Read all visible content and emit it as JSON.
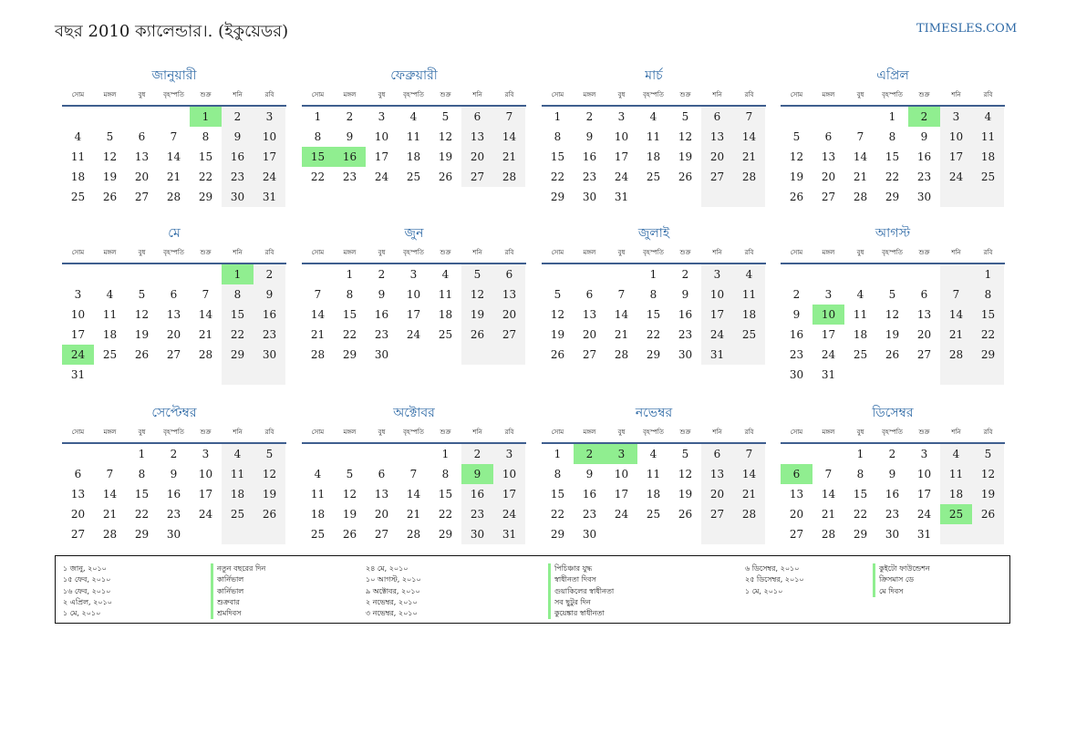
{
  "header": {
    "title": "বছর 2010 ক্যালেন্ডার।. (ইকুয়েডর)",
    "site": "TIMESLES.COM"
  },
  "weekdays": [
    "সোম",
    "মঙ্গল",
    "বুধ",
    "বৃহস্পতি",
    "শুক্র",
    "শনি",
    "রবি"
  ],
  "colors": {
    "holiday": "#90ee90",
    "weekend": "#f2f2f2",
    "accent": "#2f6aa6"
  },
  "months": [
    {
      "name": "জানুয়ারী",
      "offset": 4,
      "days": 31,
      "holidays": [
        1
      ]
    },
    {
      "name": "ফেব্রুয়ারী",
      "offset": 0,
      "days": 28,
      "holidays": [
        15,
        16
      ]
    },
    {
      "name": "মার্চ",
      "offset": 0,
      "days": 31,
      "holidays": []
    },
    {
      "name": "এপ্রিল",
      "offset": 3,
      "days": 30,
      "holidays": [
        2
      ]
    },
    {
      "name": "মে",
      "offset": 5,
      "days": 31,
      "holidays": [
        1,
        24
      ]
    },
    {
      "name": "জুন",
      "offset": 1,
      "days": 30,
      "holidays": []
    },
    {
      "name": "জুলাই",
      "offset": 3,
      "days": 31,
      "holidays": []
    },
    {
      "name": "আগস্ট",
      "offset": 6,
      "days": 31,
      "holidays": [
        10
      ]
    },
    {
      "name": "সেপ্টেম্বর",
      "offset": 2,
      "days": 30,
      "holidays": []
    },
    {
      "name": "অক্টোবর",
      "offset": 4,
      "days": 31,
      "holidays": [
        9
      ]
    },
    {
      "name": "নভেম্বর",
      "offset": 0,
      "days": 30,
      "holidays": [
        2,
        3
      ]
    },
    {
      "name": "ডিসেম্বর",
      "offset": 2,
      "days": 31,
      "holidays": [
        6,
        25
      ]
    }
  ],
  "legend": {
    "col1_dates": [
      "১ জানু, ২০১০",
      "১৫ ফেব, ২০১০",
      "১৬ ফেব, ২০১০",
      "২ এপ্রিল, ২০১০",
      "১ মে, ২০১০"
    ],
    "col1_names": [
      "নতুন বছরের দিন",
      "কার্নিভাল",
      "কার্নিভাল",
      "শুক্রবার",
      "শ্রমদিবস"
    ],
    "col2_dates": [
      "২৪ মে, ২০১০",
      "১০ আগস্ট, ২০১০",
      "৯ অক্টোবর, ২০১০",
      "২ নভেম্বর, ২০১০",
      "৩ নভেম্বর, ২০১০"
    ],
    "col2_names": [
      "পিচিঞ্চার যুদ্ধ",
      "স্বাধীনতা দিবস",
      "গুয়াকিলের স্বাধীনতা",
      "সব ছুটুর দিন",
      "কুয়েঙ্কার স্বাধীনতা"
    ],
    "col3_dates": [
      "৬ ডিসেম্বর, ২০১০",
      "২৫ ডিসেম্বর, ২০১০",
      "১ মে, ২০১০"
    ],
    "col3_names": [
      "কুইটো ফাউন্ডেশন",
      "ক্রিসমাস ডে",
      "মে দিবস"
    ]
  }
}
